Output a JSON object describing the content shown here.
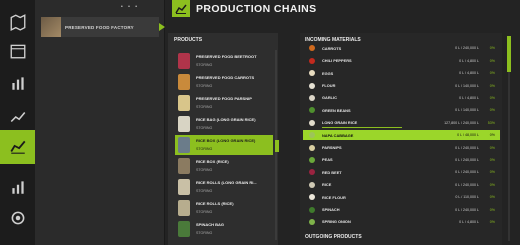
{
  "header": {
    "title": "PRODUCTION CHAINS",
    "pager_dots": "• • •"
  },
  "sidebar": {
    "items": [
      {
        "icon": "map-icon",
        "active": false
      },
      {
        "icon": "calendar-icon",
        "active": false
      },
      {
        "icon": "stats-icon",
        "active": false
      },
      {
        "icon": "finance-icon",
        "active": false
      },
      {
        "icon": "production-chains-icon",
        "active": true
      },
      {
        "icon": "chart-icon",
        "active": false
      },
      {
        "icon": "contracts-icon",
        "active": false
      }
    ]
  },
  "factory": {
    "label": "PRESERVED FOOD FACTORY"
  },
  "products": {
    "heading": "PRODUCTS",
    "items": [
      {
        "name": "PRESERVED FOOD BEETROOT",
        "status": "STORING",
        "color": "#b0344a"
      },
      {
        "name": "PRESERVED FOOD CARROTS",
        "status": "STORING",
        "color": "#c98a3b"
      },
      {
        "name": "PRESERVED FOOD PARSNIP",
        "status": "STORING",
        "color": "#d8c58a"
      },
      {
        "name": "RICE BAG (LONG GRAIN RICE)",
        "status": "STORING",
        "color": "#d8d4c4"
      },
      {
        "name": "RICE BOX (LONG GRAIN RICE)",
        "status": "STORING",
        "color": "#6b7c8a",
        "selected": true
      },
      {
        "name": "RICE BOX (RICE)",
        "status": "STORING",
        "color": "#8b7b61"
      },
      {
        "name": "RICE ROLLS (LONG GRAIN RI...",
        "status": "STORING",
        "color": "#c9c0a6"
      },
      {
        "name": "RICE ROLLS (RICE)",
        "status": "STORING",
        "color": "#b7ad8e"
      },
      {
        "name": "SPINACH BAG",
        "status": "STORING",
        "color": "#4a7a3a"
      }
    ]
  },
  "materials": {
    "heading": "INCOMING MATERIALS",
    "items": [
      {
        "name": "CARROTS",
        "amount": "0 L / 240,000 L",
        "pct": "0%",
        "color": "#d06a1e"
      },
      {
        "name": "CHILI PEPPERS",
        "amount": "0 L / 4,800 L",
        "pct": "0%",
        "color": "#c22a1e"
      },
      {
        "name": "EGGS",
        "amount": "0 L / 4,800 L",
        "pct": "0%",
        "color": "#e8dcc0"
      },
      {
        "name": "FLOUR",
        "amount": "0 L / 140,000 L",
        "pct": "0%",
        "color": "#e6e1d3"
      },
      {
        "name": "GARLIC",
        "amount": "0 L / 4,800 L",
        "pct": "0%",
        "color": "#dcd6c8"
      },
      {
        "name": "GREEN BEANS",
        "amount": "0 L / 140,000 L",
        "pct": "0%",
        "color": "#4f8f2e"
      },
      {
        "name": "LONG GRAIN RICE",
        "amount": "127,800 L / 240,000 L",
        "pct": "53%",
        "color": "#e2dccb",
        "fill": 0.53
      },
      {
        "name": "NAPA CABBAGE",
        "amount": "0 L / 48,000 L",
        "pct": "0%",
        "color": "#9dc45a",
        "highlight": true
      },
      {
        "name": "PARSNIPS",
        "amount": "0 L / 240,000 L",
        "pct": "0%",
        "color": "#d9cfa1"
      },
      {
        "name": "PEAS",
        "amount": "0 L / 240,000 L",
        "pct": "0%",
        "color": "#6aa83a"
      },
      {
        "name": "RED BEET",
        "amount": "0 L / 240,000 L",
        "pct": "0%",
        "color": "#9b2340"
      },
      {
        "name": "RICE",
        "amount": "0 L / 240,000 L",
        "pct": "0%",
        "color": "#cfc9b4"
      },
      {
        "name": "RICE FLOUR",
        "amount": "0 L / 110,000 L",
        "pct": "0%",
        "color": "#ece7da"
      },
      {
        "name": "SPINACH",
        "amount": "0 L / 240,000 L",
        "pct": "0%",
        "color": "#3f7a2c"
      },
      {
        "name": "SPRING ONION",
        "amount": "0 L / 4,800 L",
        "pct": "0%",
        "color": "#7fb34a"
      }
    ],
    "outgoing_heading": "OUTGOING PRODUCTS"
  }
}
